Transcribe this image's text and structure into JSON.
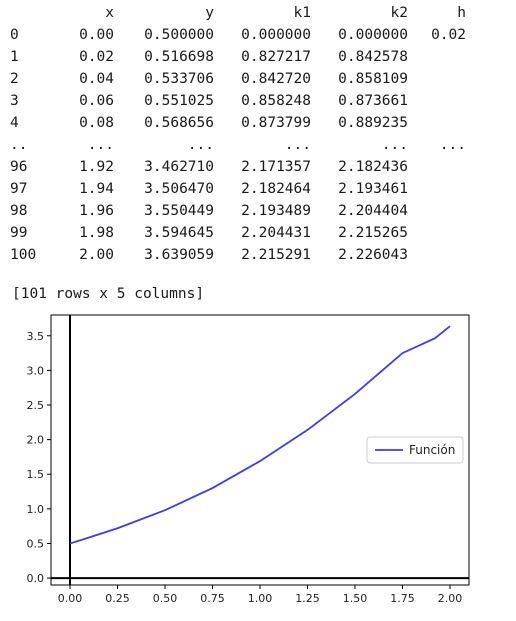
{
  "dataframe": {
    "columns": [
      "x",
      "y",
      "k1",
      "k2",
      "h"
    ],
    "rows": [
      {
        "index": "0",
        "cells": [
          "0.00",
          "0.500000",
          "0.000000",
          "0.000000",
          "0.02"
        ]
      },
      {
        "index": "1",
        "cells": [
          "0.02",
          "0.516698",
          "0.827217",
          "0.842578",
          ""
        ]
      },
      {
        "index": "2",
        "cells": [
          "0.04",
          "0.533706",
          "0.842720",
          "0.858109",
          ""
        ]
      },
      {
        "index": "3",
        "cells": [
          "0.06",
          "0.551025",
          "0.858248",
          "0.873661",
          ""
        ]
      },
      {
        "index": "4",
        "cells": [
          "0.08",
          "0.568656",
          "0.873799",
          "0.889235",
          ""
        ]
      },
      {
        "index": "..",
        "cells": [
          "...",
          "...",
          "...",
          "...",
          "..."
        ]
      },
      {
        "index": "96",
        "cells": [
          "1.92",
          "3.462710",
          "2.171357",
          "2.182436",
          ""
        ]
      },
      {
        "index": "97",
        "cells": [
          "1.94",
          "3.506470",
          "2.182464",
          "2.193461",
          ""
        ]
      },
      {
        "index": "98",
        "cells": [
          "1.96",
          "3.550449",
          "2.193489",
          "2.204404",
          ""
        ]
      },
      {
        "index": "99",
        "cells": [
          "1.98",
          "3.594645",
          "2.204431",
          "2.215265",
          ""
        ]
      },
      {
        "index": "100",
        "cells": [
          "2.00",
          "3.639059",
          "2.215291",
          "2.226043",
          ""
        ]
      }
    ],
    "summary": "[101 rows x 5 columns]"
  },
  "chart_data": {
    "type": "line",
    "series": [
      {
        "name": "Función",
        "color": "#3b3bf5",
        "x": [
          0.0,
          0.02,
          0.04,
          0.06,
          0.08,
          0.25,
          0.5,
          0.75,
          1.0,
          1.25,
          1.5,
          1.75,
          1.92,
          1.94,
          1.96,
          1.98,
          2.0
        ],
        "y": [
          0.5,
          0.516698,
          0.533706,
          0.551025,
          0.568656,
          0.72,
          0.98,
          1.3,
          1.69,
          2.14,
          2.66,
          3.25,
          3.46271,
          3.50647,
          3.550449,
          3.594645,
          3.639059
        ]
      }
    ],
    "xlim": [
      -0.1,
      2.1
    ],
    "ylim": [
      -0.1,
      3.8
    ],
    "xticks": [
      "0.00",
      "0.25",
      "0.50",
      "0.75",
      "1.00",
      "1.25",
      "1.50",
      "1.75",
      "2.00"
    ],
    "yticks": [
      "0.0",
      "0.5",
      "1.0",
      "1.5",
      "2.0",
      "2.5",
      "3.0",
      "3.5"
    ],
    "axis_lines": {
      "x_axis_at_y": 0,
      "y_axis_at_x": 0
    },
    "grid": false,
    "legend": "center-right"
  }
}
